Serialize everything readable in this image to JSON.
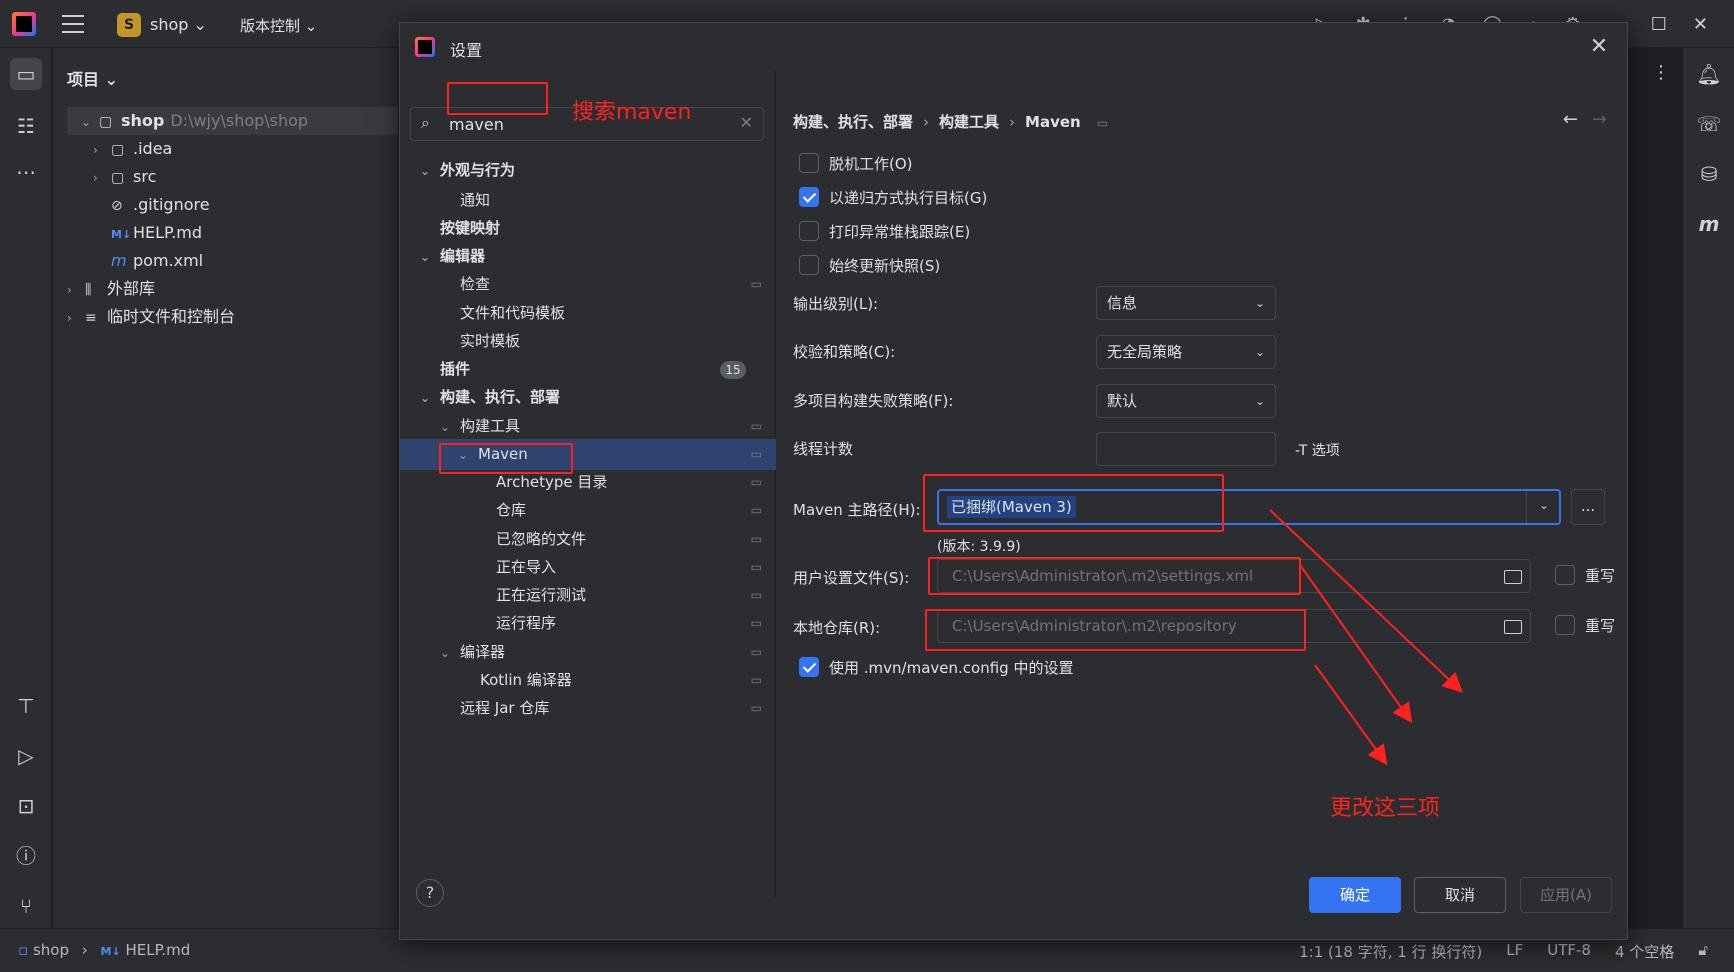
{
  "titlebar": {
    "project_badge": "S",
    "project_name": "shop ⌄",
    "vcs_menu": "版本控制 ⌄"
  },
  "project_panel": {
    "header": "项目 ⌄",
    "root_name": "shop",
    "root_path": "D:\\wjy\\shop\\shop",
    "items": [
      {
        "label": ".idea"
      },
      {
        "label": "src"
      },
      {
        "label": ".gitignore"
      },
      {
        "label": "HELP.md"
      },
      {
        "label": "pom.xml"
      },
      {
        "label": "外部库"
      },
      {
        "label": "临时文件和控制台"
      }
    ]
  },
  "dialog": {
    "title": "设置",
    "search": {
      "value": "maven"
    },
    "tree": [
      {
        "label": "外观与行为"
      },
      {
        "label": "通知"
      },
      {
        "label": "按键映射"
      },
      {
        "label": "编辑器"
      },
      {
        "label": "检查"
      },
      {
        "label": "文件和代码模板"
      },
      {
        "label": "实时模板"
      },
      {
        "label": "插件",
        "badge": "15"
      },
      {
        "label": "构建、执行、部署"
      },
      {
        "label": "构建工具"
      },
      {
        "label": "Maven"
      },
      {
        "label": "Archetype 目录"
      },
      {
        "label": "仓库"
      },
      {
        "label": "已忽略的文件"
      },
      {
        "label": "正在导入"
      },
      {
        "label": "正在运行测试"
      },
      {
        "label": "运行程序"
      },
      {
        "label": "编译器"
      },
      {
        "label": "Kotlin 编译器"
      },
      {
        "label": "远程 Jar 仓库"
      }
    ],
    "breadcrumb": [
      "构建、执行、部署",
      "构建工具",
      "Maven"
    ],
    "checkboxes": [
      {
        "label": "脱机工作(O)",
        "checked": false
      },
      {
        "label": "以递归方式执行目标(G)",
        "checked": true
      },
      {
        "label": "打印异常堆栈跟踪(E)",
        "checked": false
      },
      {
        "label": "始终更新快照(S)",
        "checked": false
      }
    ],
    "output_level": {
      "label": "输出级别(L):",
      "value": "信息"
    },
    "checksum_policy": {
      "label": "校验和策略(C):",
      "value": "无全局策略"
    },
    "multiproject_policy": {
      "label": "多项目构建失败策略(F):",
      "value": "默认"
    },
    "thread_count": {
      "label": "线程计数",
      "suffix": "-T 选项"
    },
    "maven_home": {
      "label": "Maven 主路径(H):",
      "value": "已捆绑(Maven 3)",
      "version": "(版本: 3.9.9)",
      "browse": "..."
    },
    "user_settings": {
      "label": "用户设置文件(S):",
      "placeholder": "C:\\Users\\Administrator\\.m2\\settings.xml",
      "override": "重写"
    },
    "local_repo": {
      "label": "本地仓库(R):",
      "placeholder": "C:\\Users\\Administrator\\.m2\\repository",
      "override": "重写"
    },
    "use_mvn_config": {
      "label": "使用 .mvn/maven.config 中的设置",
      "checked": true
    },
    "buttons": {
      "ok": "确定",
      "cancel": "取消",
      "apply": "应用(A)"
    }
  },
  "annotations": {
    "search_note": "搜索maven",
    "change_note": "更改这三项",
    "color": "#ff2020"
  },
  "statusbar": {
    "breadcrumb_project": "shop",
    "breadcrumb_file": "HELP.md",
    "position": "1:1 (18 字符, 1 行 换行符)",
    "line_sep": "LF",
    "encoding": "UTF-8",
    "indent": "4 个空格"
  }
}
